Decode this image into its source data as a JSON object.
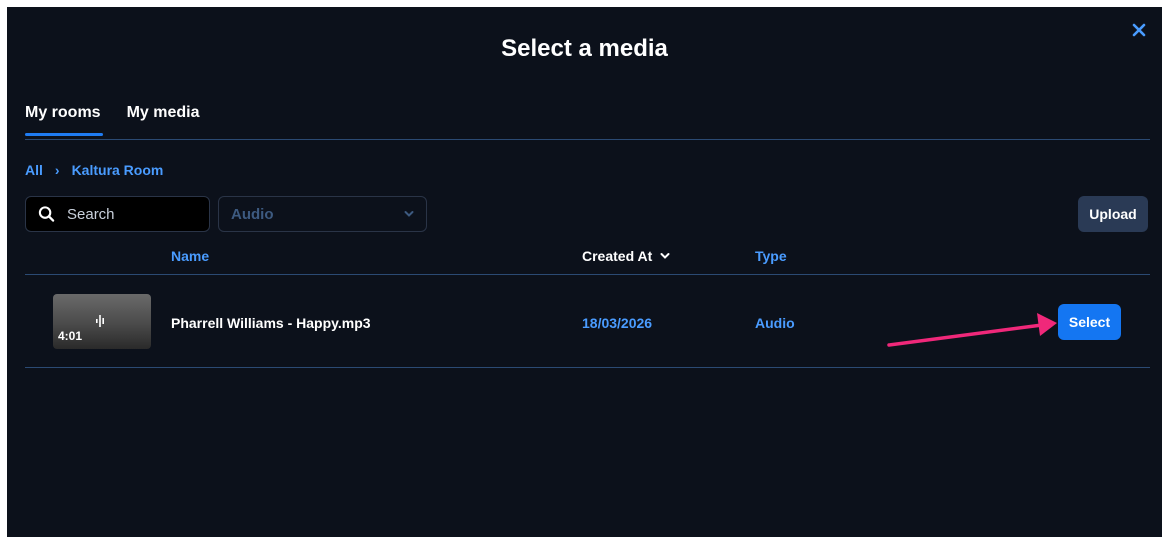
{
  "dialog": {
    "title": "Select a media"
  },
  "tabs": [
    {
      "label": "My rooms",
      "active": true
    },
    {
      "label": "My media",
      "active": false
    }
  ],
  "breadcrumb": {
    "root": "All",
    "separator": "›",
    "current": "Kaltura Room"
  },
  "filters": {
    "search_placeholder": "Search",
    "type_value": "Audio",
    "upload_label": "Upload"
  },
  "table": {
    "columns": {
      "name": "Name",
      "created_at": "Created At",
      "type": "Type"
    },
    "rows": [
      {
        "duration": "4:01",
        "name": "Pharrell Williams - Happy.mp3",
        "created_at": "18/03/2026",
        "type": "Audio",
        "action_label": "Select"
      }
    ]
  },
  "icons": {
    "close": "close-icon",
    "search": "search-icon",
    "dropdown": "chevron-down-icon",
    "sort": "chevron-down-icon",
    "audio": "audio-wave-icon"
  },
  "colors": {
    "background": "#0c111b",
    "accent": "#1476f2",
    "link": "#4a9cff",
    "annotation_arrow": "#f0287a"
  }
}
